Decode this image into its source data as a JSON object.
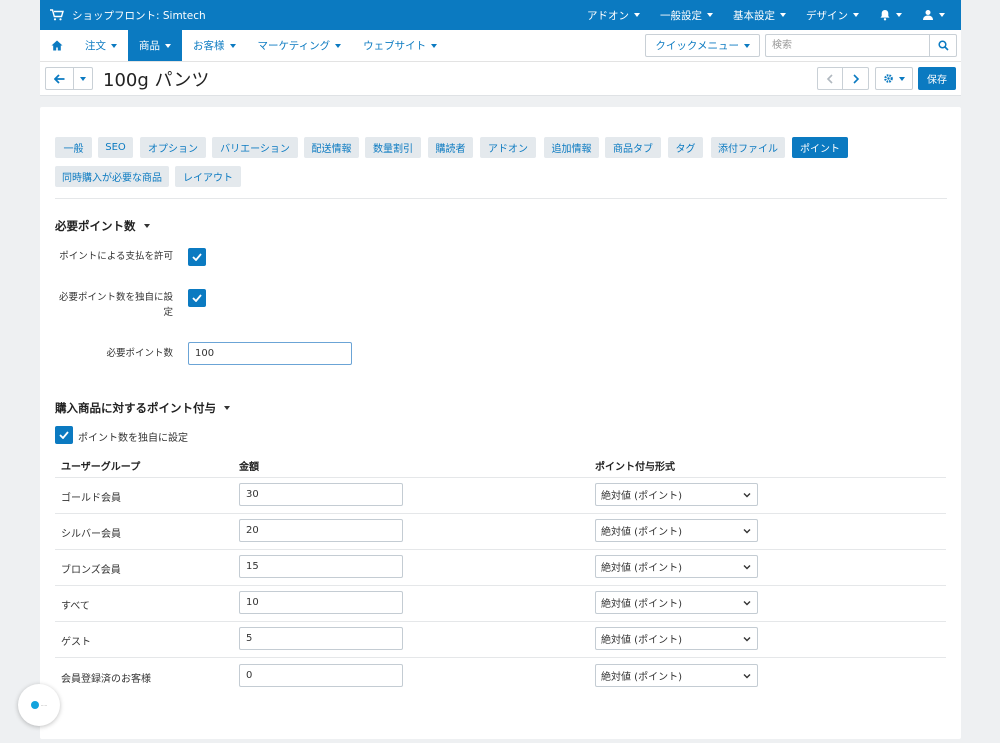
{
  "topbar": {
    "store_label": "ショップフロント: Simtech",
    "menus": [
      "アドオン",
      "一般設定",
      "基本設定",
      "デザイン"
    ]
  },
  "nav": {
    "items": [
      "注文",
      "商品",
      "お客様",
      "マーケティング",
      "ウェブサイト"
    ],
    "active": 1,
    "quick_menu": "クイックメニュー",
    "search_placeholder": "検索"
  },
  "title": {
    "page_title": "100g パンツ",
    "save_label": "保存"
  },
  "tabs": [
    "一般",
    "SEO",
    "オプション",
    "バリエーション",
    "配送情報",
    "数量割引",
    "購読者",
    "アドオン",
    "追加情報",
    "商品タブ",
    "タグ",
    "添付ファイル",
    "ポイント",
    "同時購入が必要な商品",
    "レイアウト"
  ],
  "active_tab": "ポイント",
  "section1": {
    "title": "必要ポイント数",
    "allow_pay_label": "ポイントによる支払を許可",
    "allow_pay_checked": true,
    "override_label_1": "必要ポイント数を独自に設",
    "override_label_2": "定",
    "override_checked": true,
    "points_label": "必要ポイント数",
    "points_value": "100"
  },
  "section2": {
    "title": "購入商品に対するポイント付与",
    "override_label": "ポイント数を独自に設定",
    "override_checked": true,
    "headers": [
      "ユーザーグループ",
      "金額",
      "ポイント付与形式"
    ],
    "rows": [
      {
        "group": "ゴールド会員",
        "amount": "30",
        "type": "絶対値 (ポイント)"
      },
      {
        "group": "シルバー会員",
        "amount": "20",
        "type": "絶対値 (ポイント)"
      },
      {
        "group": "ブロンズ会員",
        "amount": "15",
        "type": "絶対値 (ポイント)"
      },
      {
        "group": "すべて",
        "amount": "10",
        "type": "絶対値 (ポイント)"
      },
      {
        "group": "ゲスト",
        "amount": "5",
        "type": "絶対値 (ポイント)"
      },
      {
        "group": "会員登録済のお客様",
        "amount": "0",
        "type": "絶対値 (ポイント)"
      }
    ]
  },
  "colors": {
    "accent": "#0b7ac1",
    "tab_bg": "#e4e9ed"
  }
}
